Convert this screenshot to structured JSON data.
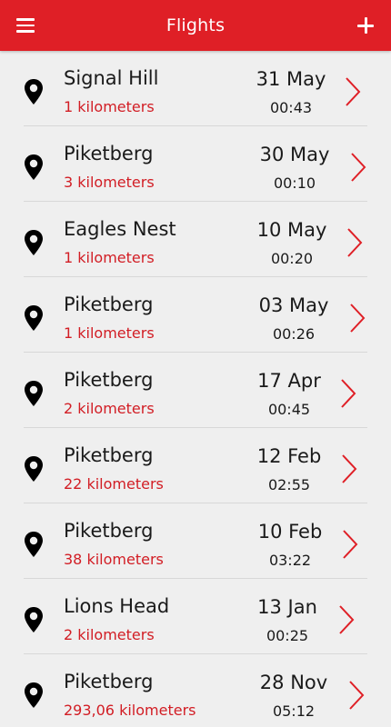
{
  "header": {
    "title": "Flights",
    "menu_icon": "hamburger-menu-icon",
    "add_icon": "plus-icon"
  },
  "colors": {
    "accent": "#df1f26",
    "distance_text": "#d21d24",
    "background": "#efefef"
  },
  "flights": [
    {
      "place": "Signal Hill",
      "distance": "1 kilometers",
      "date": "31 May",
      "time": "00:43"
    },
    {
      "place": "Piketberg",
      "distance": "3 kilometers",
      "date": "30 May",
      "time": "00:10"
    },
    {
      "place": "Eagles Nest",
      "distance": "1 kilometers",
      "date": "10 May",
      "time": "00:20"
    },
    {
      "place": "Piketberg",
      "distance": "1 kilometers",
      "date": "03 May",
      "time": "00:26"
    },
    {
      "place": "Piketberg",
      "distance": "2 kilometers",
      "date": "17 Apr",
      "time": "00:45"
    },
    {
      "place": "Piketberg",
      "distance": "22 kilometers",
      "date": "12 Feb",
      "time": "02:55"
    },
    {
      "place": "Piketberg",
      "distance": "38 kilometers",
      "date": "10 Feb",
      "time": "03:22"
    },
    {
      "place": "Lions Head",
      "distance": "2 kilometers",
      "date": "13 Jan",
      "time": "00:25"
    },
    {
      "place": "Piketberg",
      "distance": "293,06 kilometers",
      "date": "28 Nov",
      "time": "05:12"
    }
  ]
}
